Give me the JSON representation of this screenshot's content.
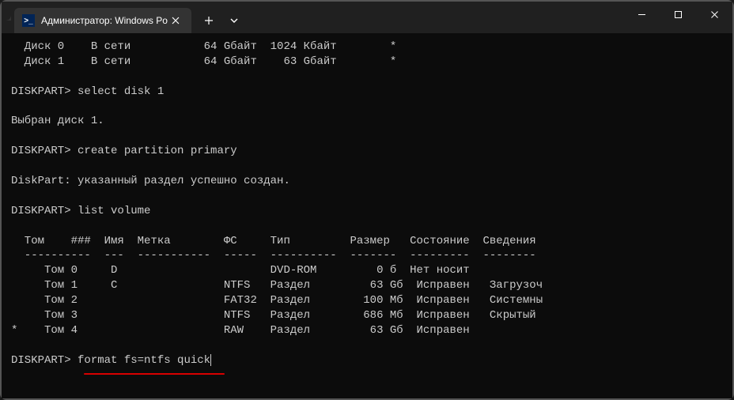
{
  "titlebar": {
    "tab_title": "Администратор: Windows Po",
    "tab_icon_text": ">_"
  },
  "terminal": {
    "disk_row0": "  Диск 0    В сети           64 Gбайт  1024 Кбайт        *",
    "disk_row1": "  Диск 1    В сети           64 Gбайт    63 Gбайт        *",
    "prompt1": "DISKPART> select disk 1",
    "msg1": "Выбран диск 1.",
    "prompt2": "DISKPART> create partition primary",
    "msg2": "DiskPart: указанный раздел успешно создан.",
    "prompt3": "DISKPART> list volume",
    "vol_header": "  Том    ###  Имя  Метка        ФС     Тип         Размер   Состояние  Сведения",
    "vol_divider": "  ----------  ---  -----------  -----  ----------  -------  ---------  --------",
    "vol_row0": "     Том 0     D                       DVD-ROM         0 б  Нет носит",
    "vol_row1": "     Том 1     C                NTFS   Раздел         63 Gб  Исправен   Загрузоч",
    "vol_row2": "     Том 2                      FAT32  Раздел        100 Мб  Исправен   Системны",
    "vol_row3": "     Том 3                      NTFS   Раздел        686 Мб  Исправен   Скрытый",
    "vol_row4": "*    Том 4                      RAW    Раздел         63 Gб  Исправен",
    "prompt4_prefix": "DISKPART> ",
    "prompt4_cmd": "format fs=ntfs quick"
  }
}
